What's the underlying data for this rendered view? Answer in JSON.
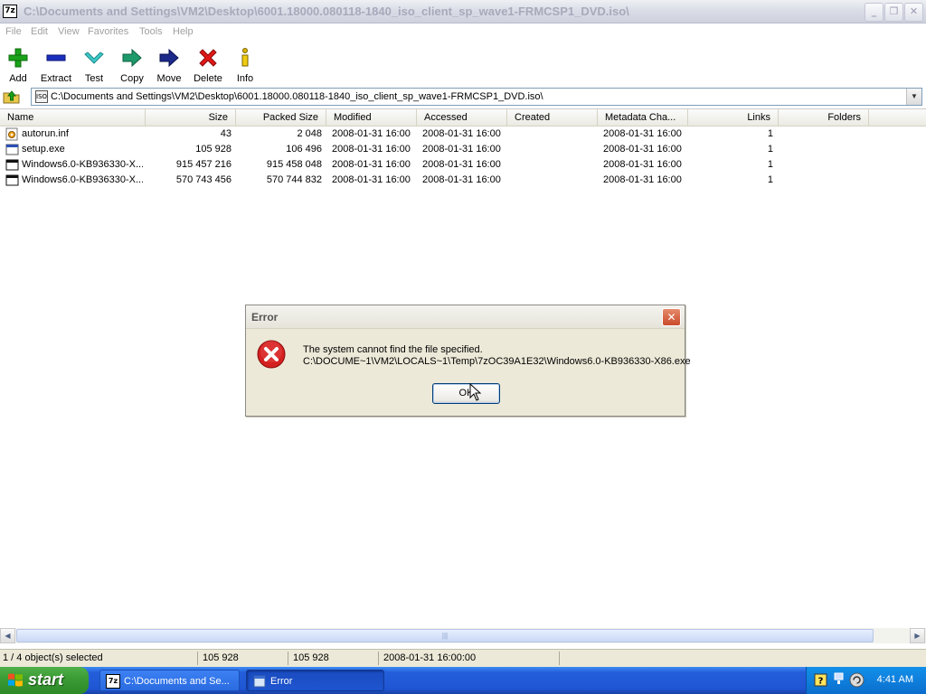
{
  "window": {
    "title": "C:\\Documents and Settings\\VM2\\Desktop\\6001.18000.080118-1840_iso_client_sp_wave1-FRMCSP1_DVD.iso\\",
    "icon_label": "7z",
    "minimize_glyph": "_",
    "maximize_glyph": "❐",
    "close_glyph": "✕"
  },
  "menu": {
    "items": [
      "File",
      "Edit",
      "View",
      "Favorites",
      "Tools",
      "Help"
    ]
  },
  "toolbar": {
    "add_label": "Add",
    "extract_label": "Extract",
    "test_label": "Test",
    "copy_label": "Copy",
    "move_label": "Move",
    "delete_label": "Delete",
    "info_label": "Info"
  },
  "address": {
    "path": "C:\\Documents and Settings\\VM2\\Desktop\\6001.18000.080118-1840_iso_client_sp_wave1-FRMCSP1_DVD.iso\\",
    "icon_label": "ISO"
  },
  "list": {
    "columns": [
      "Name",
      "Size",
      "Packed Size",
      "Modified",
      "Accessed",
      "Created",
      "Metadata Cha...",
      "Links",
      "Folders"
    ],
    "rows": [
      {
        "icon": "inf-file-icon",
        "name": "autorun.inf",
        "size": "43",
        "packed": "2 048",
        "modified": "2008-01-31 16:00",
        "accessed": "2008-01-31 16:00",
        "created": "",
        "metadata": "2008-01-31 16:00",
        "links": "1",
        "folders": ""
      },
      {
        "icon": "exe-file-icon",
        "name": "setup.exe",
        "size": "105 928",
        "packed": "106 496",
        "modified": "2008-01-31 16:00",
        "accessed": "2008-01-31 16:00",
        "created": "",
        "metadata": "2008-01-31 16:00",
        "links": "1",
        "folders": ""
      },
      {
        "icon": "exe-file-icon",
        "name": "Windows6.0-KB936330-X...",
        "size": "915 457 216",
        "packed": "915 458 048",
        "modified": "2008-01-31 16:00",
        "accessed": "2008-01-31 16:00",
        "created": "",
        "metadata": "2008-01-31 16:00",
        "links": "1",
        "folders": ""
      },
      {
        "icon": "exe-file-icon",
        "name": "Windows6.0-KB936330-X...",
        "size": "570 743 456",
        "packed": "570 744 832",
        "modified": "2008-01-31 16:00",
        "accessed": "2008-01-31 16:00",
        "created": "",
        "metadata": "2008-01-31 16:00",
        "links": "1",
        "folders": ""
      }
    ]
  },
  "statusbar": {
    "selection": "1 / 4 object(s) selected",
    "size": "105 928",
    "packed": "105 928",
    "modified": "2008-01-31 16:00:00"
  },
  "dialog": {
    "title": "Error",
    "message_line1": "The system cannot find the file specified.",
    "message_line2": "C:\\DOCUME~1\\VM2\\LOCALS~1\\Temp\\7zOC39A1E32\\Windows6.0-KB936330-X86.exe",
    "ok_label": "OK",
    "close_glyph": "✕"
  },
  "taskbar": {
    "start_label": "start",
    "tasks": [
      {
        "label": "C:\\Documents and Se...",
        "active": false
      },
      {
        "label": "Error",
        "active": true
      }
    ],
    "clock": "4:41 AM"
  },
  "colors": {
    "taskbar_blue": "#245edb",
    "start_green": "#3c9c35",
    "error_red": "#d42020",
    "dialog_face": "#ece9d8"
  }
}
